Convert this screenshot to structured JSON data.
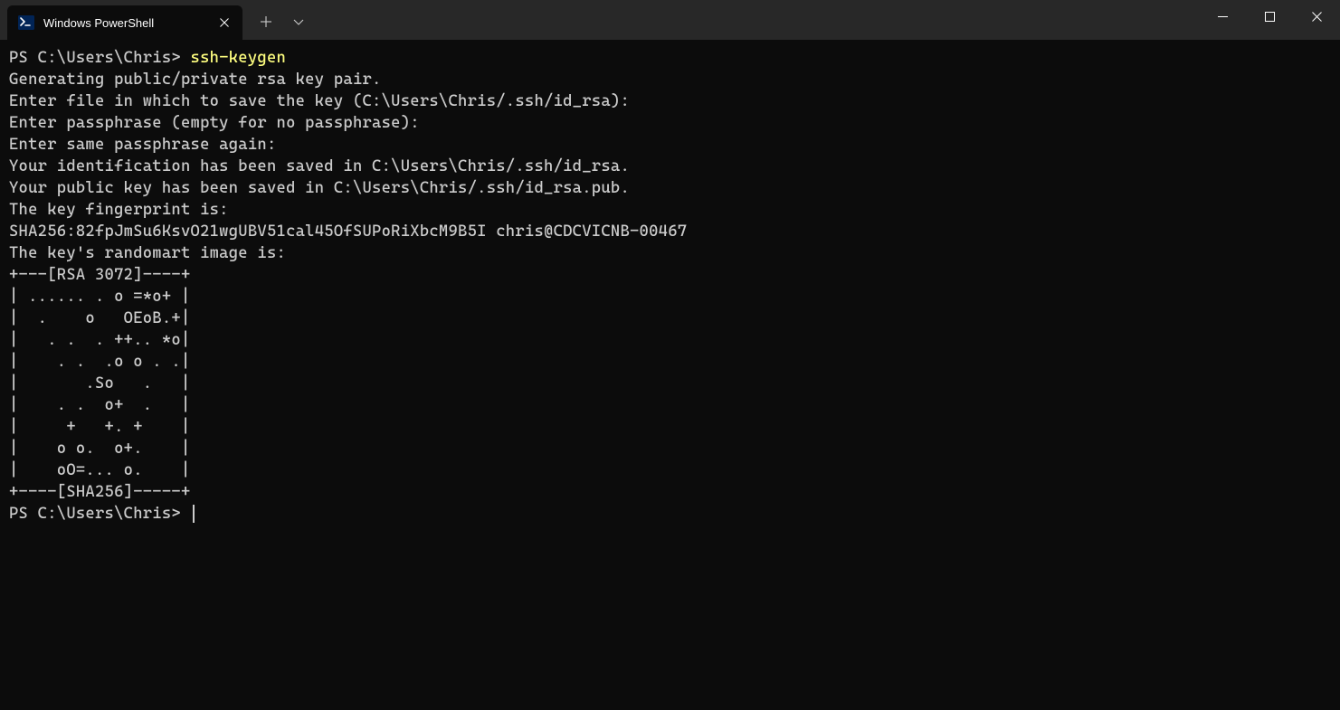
{
  "titlebar": {
    "tab_title": "Windows PowerShell",
    "tab_icon_name": "powershell-icon"
  },
  "terminal": {
    "prompt1": "PS C:\\Users\\Chris> ",
    "command1": "ssh-keygen",
    "output_lines": [
      "Generating public/private rsa key pair.",
      "Enter file in which to save the key (C:\\Users\\Chris/.ssh/id_rsa):",
      "Enter passphrase (empty for no passphrase):",
      "Enter same passphrase again:",
      "Your identification has been saved in C:\\Users\\Chris/.ssh/id_rsa.",
      "Your public key has been saved in C:\\Users\\Chris/.ssh/id_rsa.pub.",
      "The key fingerprint is:",
      "SHA256:82fpJmSu6KsvO21wgUBV51cal45OfSUPoRiXbcM9B5I chris@CDCVICNB-00467",
      "The key's randomart image is:",
      "+---[RSA 3072]----+",
      "| ...... . o =*o+ |",
      "|  .    o   OEoB.+|",
      "|   . .  . ++.. *o|",
      "|    . .  .o o . .|",
      "|       .So   .   |",
      "|    . .  o+  .   |",
      "|     +   +. +    |",
      "|    o o.  o+.    |",
      "|    oO=... o.    |",
      "+----[SHA256]-----+"
    ],
    "prompt2": "PS C:\\Users\\Chris> "
  }
}
